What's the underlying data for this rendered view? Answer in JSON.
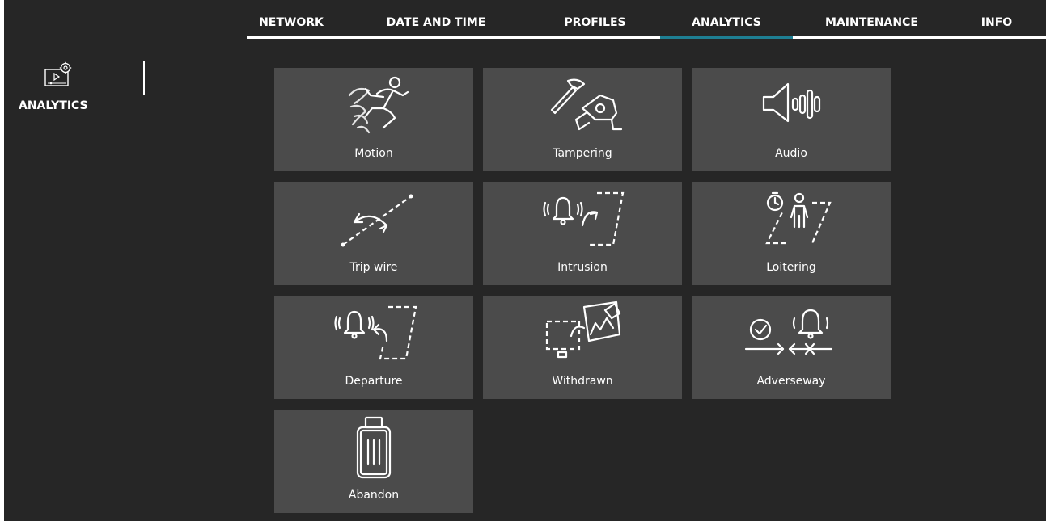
{
  "nav": {
    "tabs": [
      {
        "label": "NETWORK",
        "active": false
      },
      {
        "label": "DATE AND TIME",
        "active": false
      },
      {
        "label": "PROFILES",
        "active": false
      },
      {
        "label": "ANALYTICS",
        "active": true
      },
      {
        "label": "MAINTENANCE",
        "active": false
      },
      {
        "label": "INFO",
        "active": false
      }
    ]
  },
  "sidebar": {
    "items": [
      {
        "label": "ANALYTICS",
        "icon": "analytics-settings-icon"
      }
    ]
  },
  "tiles": [
    {
      "label": "Motion",
      "icon": "running-person-icon"
    },
    {
      "label": "Tampering",
      "icon": "hammer-camera-icon"
    },
    {
      "label": "Audio",
      "icon": "speaker-waveform-icon"
    },
    {
      "label": "Trip wire",
      "icon": "tripwire-icon"
    },
    {
      "label": "Intrusion",
      "icon": "intrusion-bell-icon"
    },
    {
      "label": "Loitering",
      "icon": "loitering-timer-person-icon"
    },
    {
      "label": "Departure",
      "icon": "departure-bell-icon"
    },
    {
      "label": "Withdrawn",
      "icon": "withdrawn-picture-icon"
    },
    {
      "label": "Adverseway",
      "icon": "adverseway-check-bell-icon"
    },
    {
      "label": "Abandon",
      "icon": "suitcase-icon"
    }
  ],
  "colors": {
    "background": "#262626",
    "tile": "#4b4b4b",
    "accent": "#1e7f93",
    "text": "#ffffff"
  }
}
